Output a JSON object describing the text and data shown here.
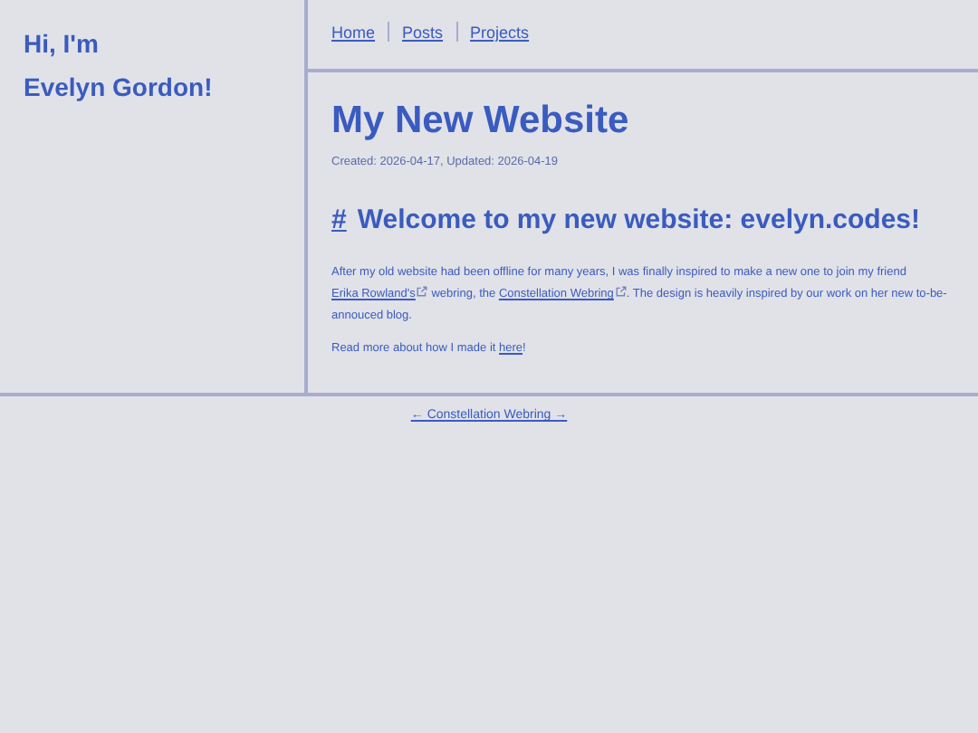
{
  "sidebar": {
    "greeting": [
      "Hi, I'm",
      "Evelyn Gordon!"
    ]
  },
  "nav": [
    {
      "label": "Home"
    },
    {
      "label": "Posts"
    },
    {
      "label": "Projects"
    }
  ],
  "article": {
    "title": "My New Website",
    "meta": "Created: 2026-04-17, Updated: 2026-04-19",
    "heading": {
      "anchor": "#",
      "text": "Welcome to my new website: evelyn.codes!"
    },
    "paragraphs": [
      [
        {
          "kind": "text",
          "text": "After my old website had been offline for many years, I was finally inspired to make a new one to join my friend "
        },
        {
          "kind": "link",
          "text": "Erika Rowland's",
          "external": true
        },
        {
          "kind": "text",
          "text": " webring, the "
        },
        {
          "kind": "link",
          "text": "Constellation Webring",
          "external": true
        },
        {
          "kind": "text",
          "text": ". The design is heavily inspired by our work on her new to-be-annouced blog."
        }
      ],
      [
        {
          "kind": "text",
          "text": "Read more about how I made it "
        },
        {
          "kind": "link",
          "text": "here",
          "external": false
        },
        {
          "kind": "text",
          "text": "!"
        }
      ]
    ]
  },
  "footer": {
    "webring": "← Constellation Webring →"
  }
}
